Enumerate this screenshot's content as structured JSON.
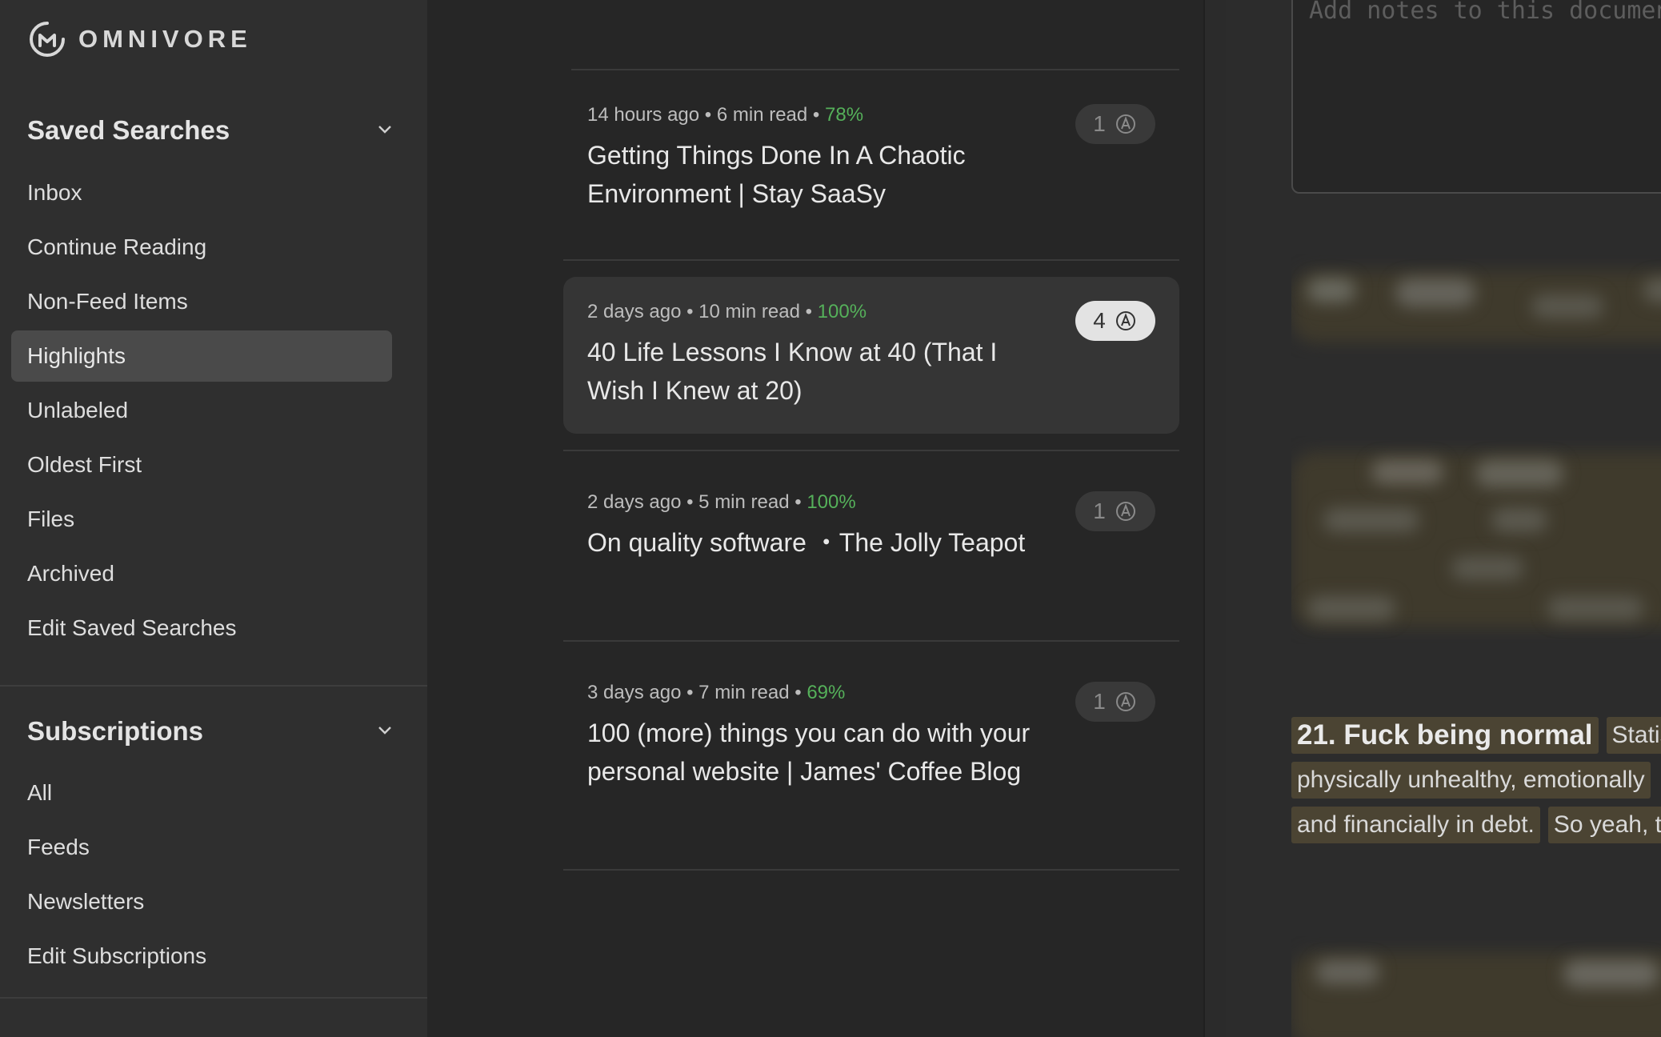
{
  "app": {
    "name": "OMNIVORE"
  },
  "sidebar": {
    "saved_searches": {
      "title": "Saved Searches",
      "items": [
        {
          "label": "Inbox"
        },
        {
          "label": "Continue Reading"
        },
        {
          "label": "Non-Feed Items"
        },
        {
          "label": "Highlights"
        },
        {
          "label": "Unlabeled"
        },
        {
          "label": "Oldest First"
        },
        {
          "label": "Files"
        },
        {
          "label": "Archived"
        },
        {
          "label": "Edit Saved Searches"
        }
      ],
      "active": "Highlights"
    },
    "subscriptions": {
      "title": "Subscriptions",
      "items": [
        {
          "label": "All"
        },
        {
          "label": "Feeds"
        },
        {
          "label": "Newsletters"
        },
        {
          "label": "Edit Subscriptions"
        }
      ]
    }
  },
  "list": {
    "items": [
      {
        "time": "14 hours ago",
        "read": "6 min read",
        "progress": "78%",
        "title": "Getting Things Done In A Chaotic Environment | Stay SaaSy",
        "highlights": "1"
      },
      {
        "time": "2 days ago",
        "read": "10 min read",
        "progress": "100%",
        "title": "40 Life Lessons I Know at 40 (That I Wish I Knew at 20)",
        "highlights": "4"
      },
      {
        "time": "2 days ago",
        "read": "5 min read",
        "progress": "100%",
        "title": "On quality software ・The Jolly Teapot",
        "highlights": "1"
      },
      {
        "time": "3 days ago",
        "read": "7 min read",
        "progress": "69%",
        "title": "100 (more) things you can do with your personal website | James' Coffee Blog",
        "highlights": "1"
      }
    ],
    "separator": "•"
  },
  "reader": {
    "notes_placeholder": "Add notes to this document...",
    "highlight": {
      "heading": "21. Fuck being normal",
      "line1_tail": "Statis",
      "line2": "physically unhealthy, emotionally",
      "line3a": "and financially in debt.",
      "line3b": "So yeah, t"
    }
  },
  "colors": {
    "progress": "#55b05a",
    "highlight_bg": "#4b4433",
    "active_item": "#4a4a4a"
  }
}
